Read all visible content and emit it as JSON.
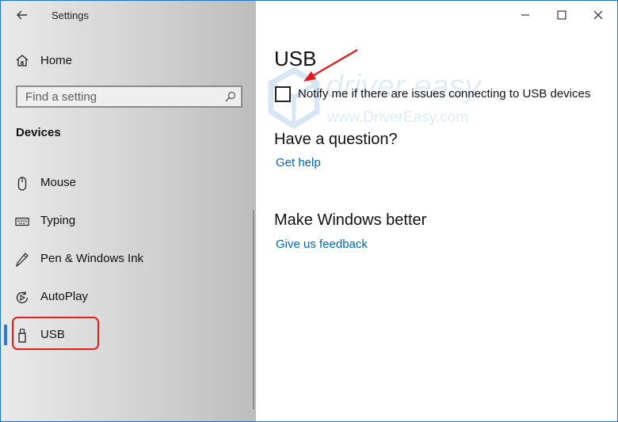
{
  "window": {
    "title": "Settings"
  },
  "sidebar": {
    "home_label": "Home",
    "search": {
      "placeholder": "Find a setting"
    },
    "section_heading": "Devices",
    "items": [
      {
        "label": "Mouse",
        "icon": "mouse-icon"
      },
      {
        "label": "Typing",
        "icon": "keyboard-icon"
      },
      {
        "label": "Pen & Windows Ink",
        "icon": "pen-icon"
      },
      {
        "label": "AutoPlay",
        "icon": "autoplay-icon"
      },
      {
        "label": "USB",
        "icon": "usb-icon",
        "selected": true
      }
    ]
  },
  "main": {
    "page_title": "USB",
    "notify_checkbox": {
      "label": "Notify me if there are issues connecting to USB devices",
      "checked": false
    },
    "question_heading": "Have a question?",
    "get_help_link": "Get help",
    "better_heading": "Make Windows better",
    "feedback_link": "Give us feedback"
  },
  "watermark": {
    "brand": "driver easy",
    "url": "www.DriverEasy.com"
  },
  "colors": {
    "accent": "#0067b8",
    "selection_bar": "#2e7bd0",
    "highlight": "#e21d1d",
    "window_border": "#1f74c7"
  }
}
